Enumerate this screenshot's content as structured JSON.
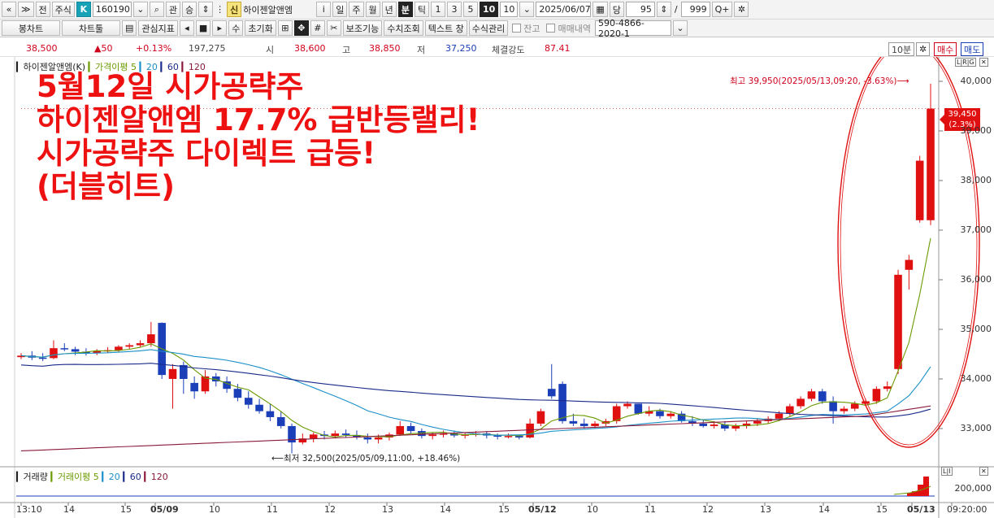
{
  "toolbar1": {
    "nav_first": "«",
    "nav_up": "≫",
    "prev_label": "전",
    "market_label": "주식",
    "k_label": "K",
    "code": "160190",
    "dropdown_icon": "chevron-down",
    "search_icon": "magnifier",
    "gwan_label": "관",
    "seung_label": "승",
    "shin_label": "신",
    "stock_name": "하이젠알앤엠",
    "info_label": "i",
    "period_day": "일",
    "period_week": "주",
    "period_month": "월",
    "period_year": "년",
    "period_minute": "분",
    "period_tick": "틱",
    "interval_1": "1",
    "interval_3": "3",
    "interval_5": "5",
    "interval_10": "10",
    "interval_value": "10",
    "date_value": "2025/06/07",
    "dang_label": "당",
    "count_value": "95",
    "slash": "/",
    "max_value": "999",
    "zoom_label": "Q+",
    "gear_icon": "gear"
  },
  "toolbar2": {
    "candle_chart": "봉차트",
    "chart_tool": "차트툴",
    "watch_index": "관심지표",
    "su_label": "수",
    "reset_label": "초기화",
    "aux_function": "보조기능",
    "numeric_lookup": "수치조회",
    "text_window": "텍스트 창",
    "formula_manage": "수식관리",
    "balance_label": "잔고",
    "trade_history_label": "매매내역",
    "account_value": "590-4866-2020-1"
  },
  "price_row": {
    "price": "38,500",
    "change": "▲50",
    "change_pct": "+0.13%",
    "volume": "197,275",
    "open_label": "시",
    "open_value": "38,600",
    "high_label": "고",
    "high_value": "38,850",
    "low_label": "저",
    "low_value": "37,250",
    "strength_label": "체결강도",
    "strength_value": "87.41",
    "period_box": "10분",
    "buy_label": "매수",
    "sell_label": "매도"
  },
  "legend": {
    "name": "하이젠알앤엠(K)",
    "ma_label": "가격이평",
    "ma5": "5",
    "ma20": "20",
    "ma60": "60",
    "ma120": "120"
  },
  "volume_legend": {
    "label": "거래량",
    "ma_label": "거래이평",
    "ma5": "5",
    "ma20": "20",
    "ma60": "60",
    "ma120": "120"
  },
  "headline": {
    "line1": "5월12일 시가공략주",
    "line2": "하이젠알앤엠 17.7% 급반등랠리!",
    "line3": "시가공략주 다이렉트 급등!",
    "line4": "(더블히트)"
  },
  "annotations": {
    "high_note": "최고 39,950(2025/05/13,09:20, -3.63%)⟶",
    "low_note": "⟵최저 32,500(2025/05/09,11:00, +18.46%)",
    "current_price": "39,450",
    "current_pct": "(2.3%)"
  },
  "y_axis": [
    "40,000",
    "39,000",
    "38,000",
    "37,000",
    "36,000",
    "35,000",
    "34,000",
    "33,000"
  ],
  "volume_axis": "200,000",
  "x_axis": [
    "13:10",
    "14",
    "15",
    "05/09",
    "10",
    "11",
    "12",
    "13",
    "14",
    "15",
    "05/12",
    "10",
    "11",
    "12",
    "13",
    "14",
    "15",
    "05/13",
    "09:20:00"
  ],
  "colors": {
    "up": "#e01010",
    "down": "#1b3fb8",
    "ma5": "#6a9a00",
    "ma20": "#1a90c8",
    "ma60": "#1a2a8a",
    "ma120": "#8a1a3a",
    "highlight_ellipse": "#e01010"
  },
  "chart_data": {
    "type": "candlestick",
    "title": "하이젠알앤엠(K)",
    "interval": "10분",
    "ylim": [
      32200,
      40300
    ],
    "candles": [
      [
        34440,
        34520,
        34400,
        34470
      ],
      [
        34470,
        34560,
        34380,
        34430
      ],
      [
        34430,
        34520,
        34360,
        34420
      ],
      [
        34420,
        34780,
        34400,
        34620
      ],
      [
        34620,
        34720,
        34560,
        34600
      ],
      [
        34600,
        34650,
        34480,
        34550
      ],
      [
        34550,
        34620,
        34470,
        34520
      ],
      [
        34520,
        34600,
        34480,
        34560
      ],
      [
        34560,
        34640,
        34520,
        34580
      ],
      [
        34580,
        34680,
        34540,
        34650
      ],
      [
        34650,
        34720,
        34600,
        34680
      ],
      [
        34680,
        34780,
        34640,
        34720
      ],
      [
        34720,
        35150,
        34650,
        34900
      ],
      [
        35130,
        35140,
        34000,
        34080
      ],
      [
        34000,
        34300,
        33400,
        34200
      ],
      [
        34280,
        34350,
        33700,
        34000
      ],
      [
        33920,
        34050,
        33600,
        33750
      ],
      [
        33750,
        34180,
        33700,
        34050
      ],
      [
        34050,
        34120,
        33850,
        33950
      ],
      [
        33950,
        34050,
        33720,
        33800
      ],
      [
        33800,
        33900,
        33550,
        33620
      ],
      [
        33620,
        33750,
        33400,
        33480
      ],
      [
        33480,
        33600,
        33300,
        33350
      ],
      [
        33350,
        33500,
        33150,
        33230
      ],
      [
        33230,
        33350,
        33000,
        33050
      ],
      [
        33050,
        33100,
        32500,
        32720
      ],
      [
        32720,
        32900,
        32680,
        32800
      ],
      [
        32800,
        32920,
        32720,
        32880
      ],
      [
        32880,
        32950,
        32780,
        32850
      ],
      [
        32850,
        32960,
        32800,
        32900
      ],
      [
        32900,
        32980,
        32820,
        32870
      ],
      [
        32870,
        32960,
        32780,
        32820
      ],
      [
        32820,
        32900,
        32700,
        32780
      ],
      [
        32780,
        32880,
        32700,
        32820
      ],
      [
        32820,
        32920,
        32760,
        32880
      ],
      [
        32880,
        33150,
        32850,
        33050
      ],
      [
        33050,
        33120,
        32900,
        32950
      ],
      [
        32950,
        33000,
        32800,
        32850
      ],
      [
        32850,
        32920,
        32780,
        32880
      ],
      [
        32880,
        32960,
        32820,
        32900
      ],
      [
        32900,
        32960,
        32820,
        32860
      ],
      [
        32860,
        32920,
        32800,
        32880
      ],
      [
        32880,
        32950,
        32840,
        32900
      ],
      [
        32900,
        32950,
        32800,
        32860
      ],
      [
        32860,
        32900,
        32780,
        32840
      ],
      [
        32840,
        32900,
        32800,
        32850
      ],
      [
        32850,
        32880,
        32780,
        32820
      ],
      [
        32820,
        33200,
        32800,
        33100
      ],
      [
        33100,
        33400,
        33050,
        33350
      ],
      [
        33800,
        34300,
        33600,
        33650
      ],
      [
        33900,
        33950,
        33100,
        33150
      ],
      [
        33150,
        33300,
        33050,
        33100
      ],
      [
        33100,
        33200,
        33000,
        33050
      ],
      [
        33050,
        33150,
        33000,
        33100
      ],
      [
        33100,
        33200,
        33050,
        33150
      ],
      [
        33150,
        33500,
        33100,
        33450
      ],
      [
        33450,
        33550,
        33400,
        33500
      ],
      [
        33500,
        33500,
        33280,
        33300
      ],
      [
        33300,
        33450,
        33250,
        33350
      ],
      [
        33350,
        33400,
        33200,
        33250
      ],
      [
        33250,
        33350,
        33200,
        33300
      ],
      [
        33300,
        33350,
        33120,
        33150
      ],
      [
        33150,
        33250,
        33050,
        33100
      ],
      [
        33100,
        33180,
        33020,
        33050
      ],
      [
        33050,
        33150,
        33000,
        33080
      ],
      [
        33080,
        33150,
        32950,
        33000
      ],
      [
        33000,
        33100,
        32950,
        33050
      ],
      [
        33050,
        33150,
        33000,
        33100
      ],
      [
        33100,
        33200,
        33050,
        33150
      ],
      [
        33150,
        33250,
        33100,
        33200
      ],
      [
        33200,
        33350,
        33150,
        33300
      ],
      [
        33300,
        33500,
        33250,
        33450
      ],
      [
        33450,
        33650,
        33400,
        33600
      ],
      [
        33600,
        33800,
        33550,
        33750
      ],
      [
        33750,
        33800,
        33500,
        33550
      ],
      [
        33550,
        33650,
        33100,
        33350
      ],
      [
        33350,
        33450,
        33300,
        33400
      ],
      [
        33400,
        33550,
        33350,
        33500
      ],
      [
        33500,
        33600,
        33450,
        33550
      ],
      [
        33550,
        33850,
        33500,
        33800
      ],
      [
        33800,
        33950,
        33750,
        33850
      ],
      [
        34200,
        36200,
        34100,
        36100
      ],
      [
        36200,
        36500,
        35800,
        36400
      ],
      [
        37200,
        38500,
        37150,
        38400
      ],
      [
        37200,
        39950,
        37100,
        39450
      ]
    ],
    "volume_axis_label": "200,000"
  }
}
